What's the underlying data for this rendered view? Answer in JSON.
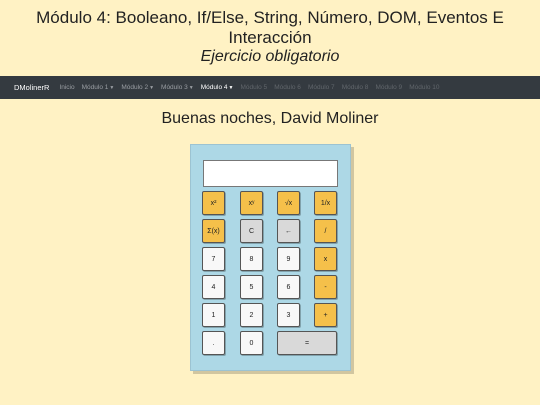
{
  "header": {
    "title": "Módulo 4: Booleano, If/Else, String, Número, DOM, Eventos E Interacción",
    "subtitle": "Ejercicio obligatorio"
  },
  "navbar": {
    "brand": "DMolinerR",
    "links": [
      {
        "label": "Inicio",
        "state": "normal"
      },
      {
        "label": "Módulo 1",
        "state": "normal",
        "dropdown": true
      },
      {
        "label": "Módulo 2",
        "state": "normal",
        "dropdown": true
      },
      {
        "label": "Módulo 3",
        "state": "normal",
        "dropdown": true
      },
      {
        "label": "Módulo 4",
        "state": "active",
        "dropdown": true
      },
      {
        "label": "Módulo 5",
        "state": "disabled"
      },
      {
        "label": "Módulo 6",
        "state": "disabled"
      },
      {
        "label": "Módulo 7",
        "state": "disabled"
      },
      {
        "label": "Módulo 8",
        "state": "disabled"
      },
      {
        "label": "Módulo 9",
        "state": "disabled"
      },
      {
        "label": "Módulo 10",
        "state": "disabled"
      }
    ]
  },
  "greeting": "Buenas noches, David Moliner",
  "calculator": {
    "display_value": "",
    "keys": {
      "square": "x²",
      "power": "xʸ",
      "sqrt": "√x",
      "inverse": "1/x",
      "factorial": "Σ(x)",
      "clear": "C",
      "backspace": "←",
      "divide": "/",
      "seven": "7",
      "eight": "8",
      "nine": "9",
      "multiply": "x",
      "four": "4",
      "five": "5",
      "six": "6",
      "minus": "-",
      "one": "1",
      "two": "2",
      "three": "3",
      "plus": "+",
      "dot": ".",
      "zero": "0",
      "equals": "="
    }
  },
  "colors": {
    "page_bg": "#fff2c4",
    "navbar_bg": "#343a40",
    "calc_bg": "#add8e6",
    "operator_key": "#f5c04a"
  }
}
